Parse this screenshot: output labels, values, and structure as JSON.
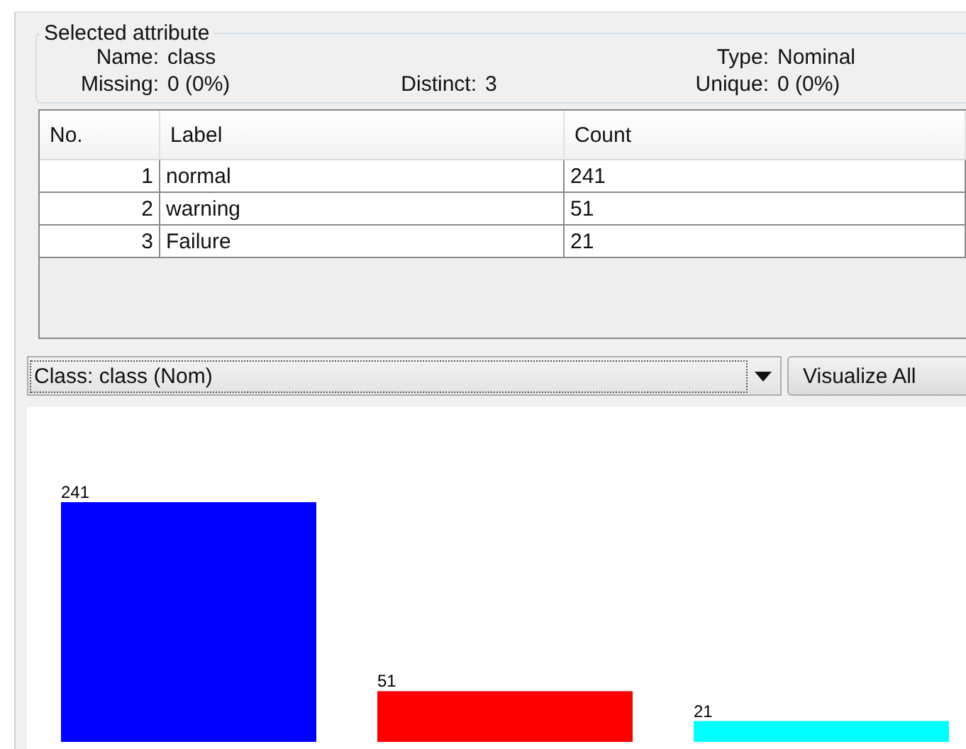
{
  "selected_attribute": {
    "title": "Selected attribute",
    "fields": [
      {
        "label": "Name:",
        "value": "class"
      },
      {
        "label": "Type:",
        "value": "Nominal"
      },
      {
        "label": "Missing:",
        "value": "0 (0%)"
      },
      {
        "label": "Distinct:",
        "value": "3"
      },
      {
        "label": "Unique:",
        "value": "0 (0%)"
      }
    ]
  },
  "table": {
    "columns": [
      "No.",
      "Label",
      "Count"
    ],
    "rows": [
      [
        "1",
        "normal",
        "241"
      ],
      [
        "2",
        "warning",
        "51"
      ],
      [
        "3",
        "Failure",
        "21"
      ]
    ]
  },
  "class_selector": {
    "value": "Class: class (Nom)"
  },
  "visualize_button": {
    "label": "Visualize All"
  },
  "histogram": {
    "chart_data": {
      "type": "bar",
      "data_labels": true,
      "series": [
        {
          "color": "#0000ff",
          "values": [
            241
          ]
        },
        {
          "color": "#ff0000",
          "values": [
            51
          ]
        },
        {
          "color": "#00ffff",
          "values": [
            21
          ]
        }
      ]
    }
  }
}
